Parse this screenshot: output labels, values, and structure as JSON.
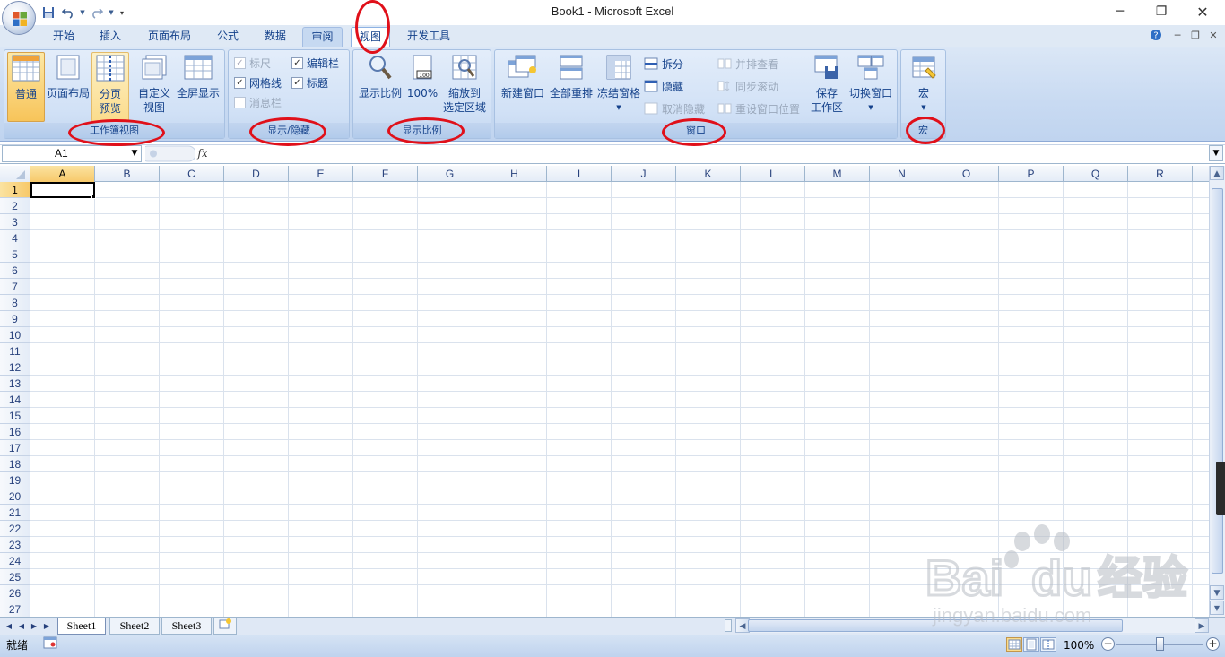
{
  "window": {
    "title": "Book1 - Microsoft Excel"
  },
  "qat": {
    "save_icon": "save-icon",
    "undo_icon": "undo-icon",
    "redo_icon": "redo-icon"
  },
  "tabs": [
    {
      "label": "开始"
    },
    {
      "label": "插入"
    },
    {
      "label": "页面布局"
    },
    {
      "label": "公式"
    },
    {
      "label": "数据"
    },
    {
      "label": "审阅"
    },
    {
      "label": "视图"
    },
    {
      "label": "开发工具"
    }
  ],
  "ribbon": {
    "workbook_views": {
      "label": "工作簿视图",
      "normal": "普通",
      "page_layout": "页面布局",
      "page_break_1": "分页",
      "page_break_2": "预览",
      "custom_1": "自定义",
      "custom_2": "视图",
      "fullscreen": "全屏显示"
    },
    "show_hide": {
      "label": "显示/隐藏",
      "ruler": "标尺",
      "gridlines": "网格线",
      "message_bar": "消息栏",
      "formula_bar": "编辑栏",
      "headings": "标题"
    },
    "zoom": {
      "label": "显示比例",
      "zoom": "显示比例",
      "hundred": "100%",
      "to_selection_1": "缩放到",
      "to_selection_2": "选定区域"
    },
    "window": {
      "label": "窗口",
      "new_window": "新建窗口",
      "arrange_all": "全部重排",
      "freeze_panes": "冻结窗格",
      "split": "拆分",
      "hide": "隐藏",
      "unhide": "取消隐藏",
      "side_by_side": "并排查看",
      "sync_scroll": "同步滚动",
      "reset_position": "重设窗口位置",
      "save_workspace_1": "保存",
      "save_workspace_2": "工作区",
      "switch_windows": "切换窗口"
    },
    "macros": {
      "label": "宏",
      "macros": "宏"
    }
  },
  "formula_bar": {
    "name_box": "A1",
    "fx": "fx",
    "value": ""
  },
  "grid": {
    "columns": [
      "A",
      "B",
      "C",
      "D",
      "E",
      "F",
      "G",
      "H",
      "I",
      "J",
      "K",
      "L",
      "M",
      "N",
      "O",
      "P",
      "Q",
      "R"
    ],
    "rows": [
      "1",
      "2",
      "3",
      "4",
      "5",
      "6",
      "7",
      "8",
      "9",
      "10",
      "11",
      "12",
      "13",
      "14",
      "15",
      "16",
      "17",
      "18",
      "19",
      "20",
      "21",
      "22",
      "23",
      "24",
      "25",
      "26",
      "27"
    ],
    "active_cell": "A1"
  },
  "sheets": [
    {
      "label": "Sheet1"
    },
    {
      "label": "Sheet2"
    },
    {
      "label": "Sheet3"
    }
  ],
  "status": {
    "ready": "就绪",
    "zoom": "100%"
  },
  "watermark": {
    "brand": "Bai",
    "brand2": "du",
    "brand_cn": "经验",
    "url": "jingyan.baidu.com"
  }
}
